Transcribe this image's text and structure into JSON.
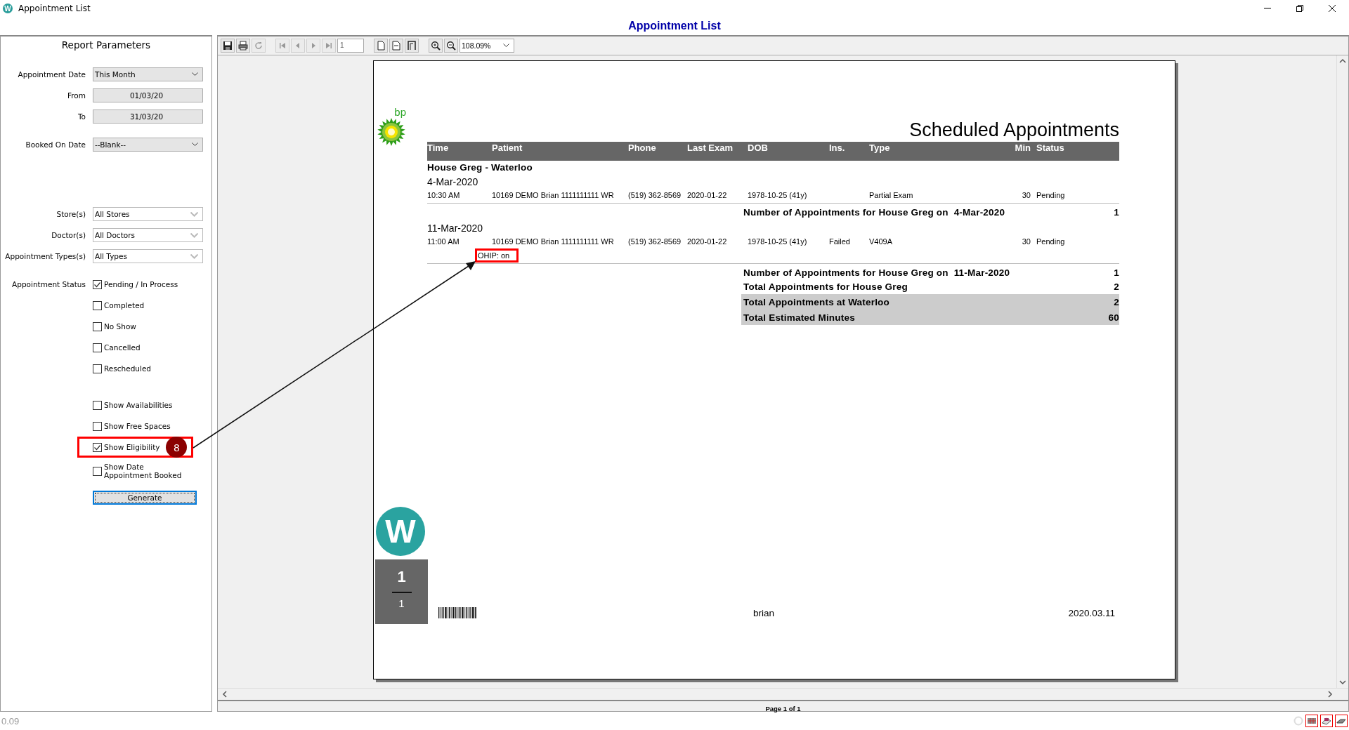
{
  "window": {
    "icon_letter": "W",
    "title": "Appointment List"
  },
  "header": {
    "title": "Appointment List"
  },
  "parameters": {
    "title": "Report Parameters",
    "date_fields": [
      {
        "kind": "dropdown",
        "label": "Appointment Date",
        "value": "This Month"
      },
      {
        "kind": "date",
        "label": "From",
        "value": "01/03/20"
      },
      {
        "kind": "date",
        "label": "To",
        "value": "31/03/20"
      },
      {
        "kind": "dropdown",
        "label": "Booked On Date",
        "value": "--Blank--"
      }
    ],
    "filter_fields": [
      {
        "label": "Store(s)",
        "value": "All Stores"
      },
      {
        "label": "Doctor(s)",
        "value": "All Doctors"
      },
      {
        "label": "Appointment Types(s)",
        "value": "All Types"
      }
    ],
    "status_label": "Appointment Status",
    "statuses": [
      {
        "label": "Pending / In Process",
        "checked": true
      },
      {
        "label": "Completed",
        "checked": false
      },
      {
        "label": "No Show",
        "checked": false
      },
      {
        "label": "Cancelled",
        "checked": false
      },
      {
        "label": "Rescheduled",
        "checked": false
      }
    ],
    "options": [
      {
        "label": "Show Availabilities",
        "checked": false,
        "annotated": false
      },
      {
        "label": "Show Free Spaces",
        "checked": false,
        "annotated": false
      },
      {
        "label": "Show Eligibility",
        "checked": true,
        "annotated": true
      },
      {
        "label": "Show Date Appointment Booked",
        "checked": false,
        "annotated": false
      }
    ],
    "generate_button": "Generate"
  },
  "annotation": {
    "badge": "8"
  },
  "toolbar": {
    "buttons": [
      {
        "kind": "save",
        "disabled": false
      },
      {
        "kind": "print",
        "disabled": false
      },
      {
        "kind": "refresh",
        "disabled": true
      },
      {
        "kind": "first",
        "disabled": true
      },
      {
        "kind": "prev",
        "disabled": true
      },
      {
        "kind": "next",
        "disabled": true
      },
      {
        "kind": "last",
        "disabled": true
      }
    ],
    "page": "1",
    "view_buttons": [
      {
        "kind": "page",
        "disabled": false
      },
      {
        "kind": "width",
        "disabled": false
      },
      {
        "kind": "full",
        "disabled": false
      }
    ],
    "zoom_buttons": [
      {
        "kind": "zoom-in"
      },
      {
        "kind": "zoom-out"
      }
    ],
    "zoom": "108.09%"
  },
  "report": {
    "logo_text": "bp",
    "title": "Scheduled Appointments",
    "columns": [
      "Time",
      "Patient",
      "Phone",
      "Last Exam",
      "DOB",
      "Ins.",
      "Type",
      "Min",
      "Status"
    ],
    "group": "House Greg - Waterloo",
    "days": [
      {
        "date": "4-Mar-2020",
        "appointments": [
          {
            "cells": [
              "10:30 AM",
              "10169 DEMO Brian 1111111111 WR",
              "(519) 362-8569",
              "2020-01-22",
              "1978-10-25 (41y)",
              "",
              "Partial Exam",
              "30",
              "Pending"
            ]
          }
        ],
        "summary_label": "Number of Appointments for House Greg on  4-Mar-2020",
        "summary_value": "1"
      },
      {
        "date": "11-Mar-2020",
        "appointments": [
          {
            "cells": [
              "11:00 AM",
              "10169 DEMO Brian 1111111111 WR",
              "(519) 362-8569",
              "2020-01-22",
              "1978-10-25 (41y)",
              "Failed",
              "V409A",
              "30",
              "Pending"
            ],
            "eligibility": "OHIP: on",
            "annotated": true
          }
        ],
        "summary_label": "Number of Appointments for House Greg on  11-Mar-2020",
        "summary_value": "1"
      }
    ],
    "totals": [
      {
        "label": "Total Appointments for House Greg",
        "value": "2",
        "shaded": false
      },
      {
        "label": "Total Appointments at Waterloo",
        "value": "2",
        "shaded": true
      },
      {
        "label": "Total Estimated Minutes",
        "value": "60",
        "shaded": true
      }
    ],
    "footer": {
      "logo_letter": "W",
      "page": "1",
      "pages": "1",
      "user": "brian",
      "date": "2020.03.11"
    }
  },
  "page_bar": "Page 1 of 1",
  "status_bar": {
    "version": "0.09"
  }
}
